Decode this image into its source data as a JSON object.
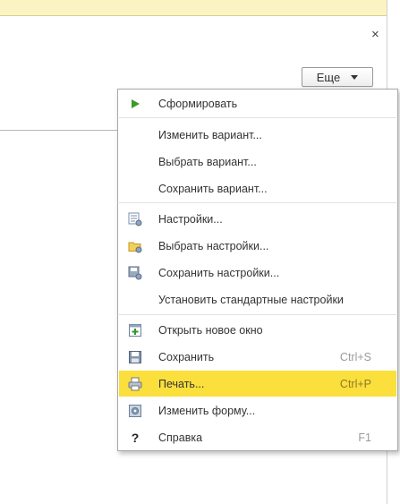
{
  "window": {
    "close_glyph": "×"
  },
  "more_button": {
    "label": "Еще"
  },
  "menu": {
    "items": [
      {
        "label": "Сформировать",
        "icon": "play-icon",
        "shortcut": ""
      },
      {
        "label": "Изменить вариант...",
        "icon": "",
        "shortcut": ""
      },
      {
        "label": "Выбрать вариант...",
        "icon": "",
        "shortcut": ""
      },
      {
        "label": "Сохранить вариант...",
        "icon": "",
        "shortcut": ""
      },
      {
        "label": "Настройки...",
        "icon": "settings-icon",
        "shortcut": ""
      },
      {
        "label": "Выбрать настройки...",
        "icon": "folder-settings-icon",
        "shortcut": ""
      },
      {
        "label": "Сохранить настройки...",
        "icon": "save-settings-icon",
        "shortcut": ""
      },
      {
        "label": "Установить стандартные настройки",
        "icon": "",
        "shortcut": ""
      },
      {
        "label": "Открыть новое окно",
        "icon": "new-window-icon",
        "shortcut": ""
      },
      {
        "label": "Сохранить",
        "icon": "floppy-icon",
        "shortcut": "Ctrl+S"
      },
      {
        "label": "Печать...",
        "icon": "printer-icon",
        "shortcut": "Ctrl+P",
        "highlighted": true
      },
      {
        "label": "Изменить форму...",
        "icon": "form-edit-icon",
        "shortcut": ""
      },
      {
        "label": "Справка",
        "icon": "help-icon",
        "shortcut": "F1"
      }
    ]
  },
  "colors": {
    "highlight": "#fbdf3c",
    "topbar": "#fbf4c2",
    "play": "#3a9a2a"
  }
}
